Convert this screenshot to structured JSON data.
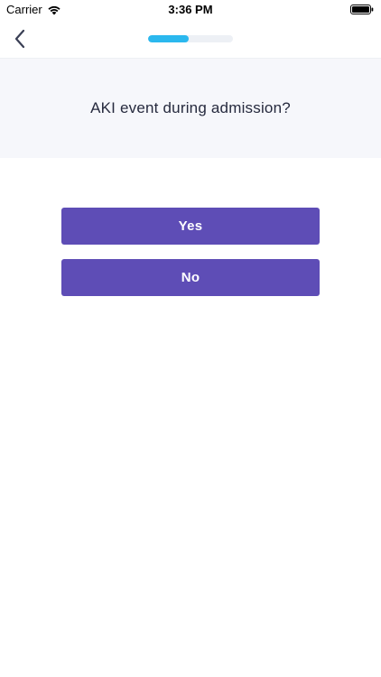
{
  "status_bar": {
    "carrier": "Carrier",
    "time": "3:36 PM",
    "wifi_icon": "wifi-icon",
    "battery_icon": "battery-icon"
  },
  "nav": {
    "back_icon": "chevron-left-icon",
    "progress_fraction": 0.48,
    "progress_color": "#2bb8ee",
    "track_color": "#edf0f5"
  },
  "question": {
    "title": "AKI event during admission?"
  },
  "answers": [
    {
      "label": "Yes"
    },
    {
      "label": "No"
    }
  ],
  "colors": {
    "button": "#5e4db6",
    "question_panel": "#f6f7fb"
  }
}
